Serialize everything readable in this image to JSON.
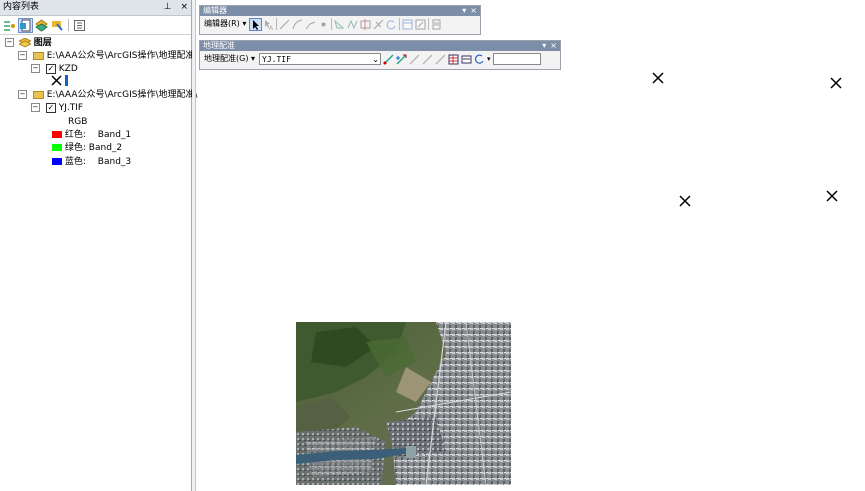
{
  "toc": {
    "title": "内容列表",
    "pin_glyph": "ㅁ",
    "close_glyph": "×",
    "root_label": "图层",
    "groups": [
      {
        "path": "E:\\AAA公众号\\ArcGIS操作\\地理配准",
        "layer": "KZD"
      },
      {
        "path": "E:\\AAA公众号\\ArcGIS操作\\地理配准\\",
        "layer": "YJ.TIF"
      }
    ],
    "rgb_label": "RGB",
    "bands": [
      {
        "color_name": "红色:",
        "band": "Band_1",
        "color": "#ff0000"
      },
      {
        "color_name": "绿色:",
        "band": "Band_2",
        "color": "#00ff00"
      },
      {
        "color_name": "蓝色:",
        "band": "Band_3",
        "color": "#0000ff"
      }
    ]
  },
  "editor_toolbar": {
    "title": "编辑器",
    "menu_label": "编辑器(R) ▾"
  },
  "georef_toolbar": {
    "title": "地理配准",
    "menu_label": "地理配准(G) ▾",
    "layer_value": "YJ.TIF",
    "input_value": ""
  },
  "map": {
    "control_point_glyph": "×",
    "control_point_count": 4
  },
  "colors": {
    "panel_bg": "#ffffff",
    "title_bg": "#dfe3ea",
    "toolbar_caption": "#7d8ea8",
    "selection": "#cddff6"
  }
}
